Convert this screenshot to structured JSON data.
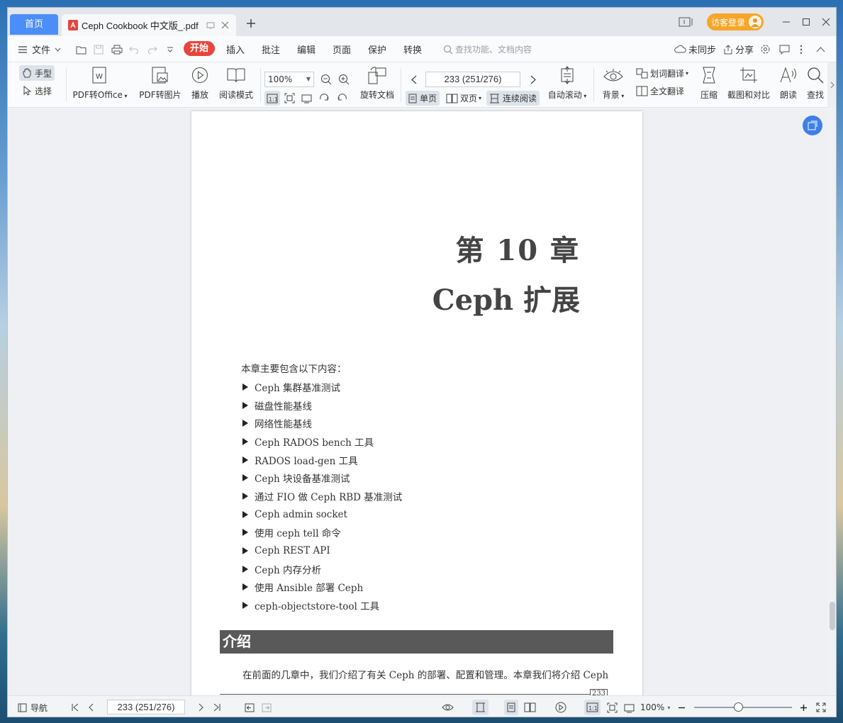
{
  "titlebar": {
    "home_tab": "首页",
    "doc_tab_title": "Ceph Cookbook 中文版_.pdf",
    "login_label": "访客登录"
  },
  "menubar": {
    "file": "文件",
    "start": "开始",
    "items": [
      "插入",
      "批注",
      "编辑",
      "页面",
      "保护",
      "转换"
    ],
    "search_placeholder": "查找功能、文档内容",
    "unsync": "未同步",
    "share": "分享"
  },
  "ribbon": {
    "hand": "手型",
    "select": "选择",
    "pdf_to_office": "PDF转Office",
    "pdf_to_image": "PDF转图片",
    "play": "播放",
    "read_mode": "阅读模式",
    "zoom": "100%",
    "rotate_doc": "旋转文档",
    "page_field": "233 (251/276)",
    "single_page": "单页",
    "double_page": "双页",
    "continuous": "连续阅读",
    "auto_scroll": "自动滚动",
    "background": "背景",
    "word_translate": "划词翻译",
    "full_translate": "全文翻译",
    "compress": "压缩",
    "screenshot_compare": "截图和对比",
    "read_aloud": "朗读",
    "find": "查找"
  },
  "page": {
    "chapter_number": "第 10 章",
    "chapter_title": "Ceph 扩展",
    "intro_lead": "本章主要包含以下内容：",
    "topics": [
      "Ceph 集群基准测试",
      "磁盘性能基线",
      "网络性能基线",
      "Ceph RADOS bench 工具",
      "RADOS load-gen 工具",
      "Ceph 块设备基准测试",
      "通过 FIO 做 Ceph RBD 基准测试",
      "Ceph admin socket",
      "使用 ceph tell 命令",
      "Ceph REST API",
      "Ceph 内存分析",
      "使用 Ansible 部署 Ceph",
      "ceph-objectstore-tool 工具"
    ],
    "section_heading": "介绍",
    "paragraph": "在前面的几章中，我们介绍了有关 Ceph 的部署、配置和管理。本章我们将介绍 Ceph",
    "page_number": "233"
  },
  "statusbar": {
    "nav": "导航",
    "page_field": "233 (251/276)",
    "zoom": "100%",
    "zoom_fraction": 0.45
  }
}
